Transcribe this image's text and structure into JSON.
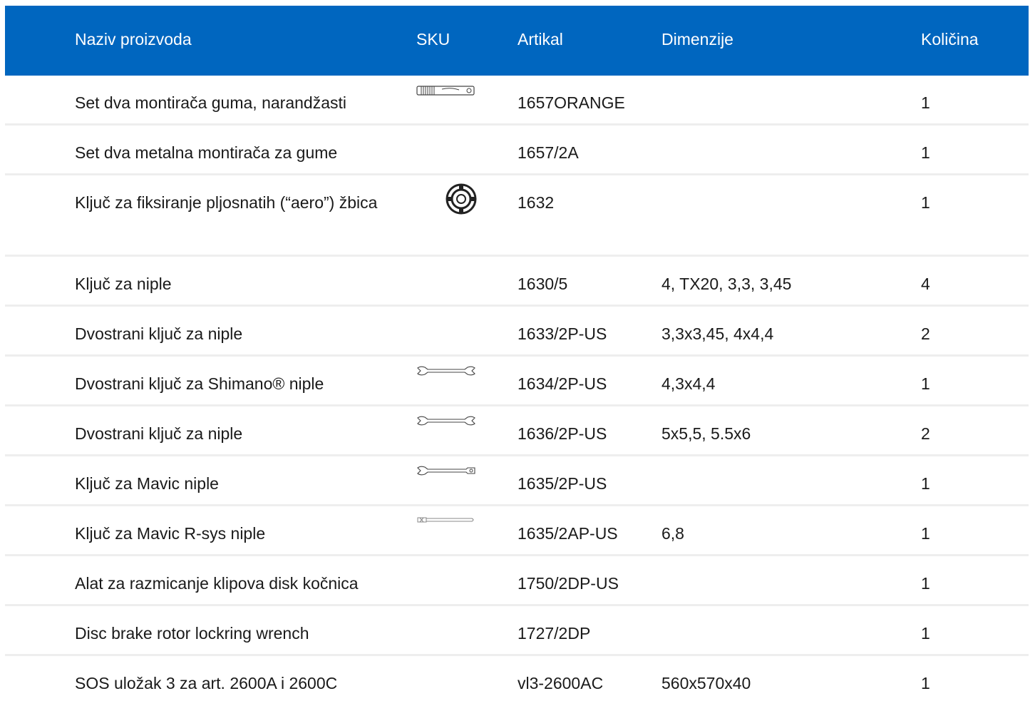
{
  "header": {
    "name": "Naziv proizvoda",
    "sku": "SKU",
    "article": "Artikal",
    "dimensions": "Dimenzije",
    "quantity": "Količina"
  },
  "rows": [
    {
      "name": "Set dva montirača guma, narandžasti",
      "sku_icon": "tire-lever-icon",
      "article": "1657ORANGE",
      "dimensions": "",
      "quantity": "1"
    },
    {
      "name": "Set dva metalna montirača za gume",
      "sku_icon": "",
      "article": "1657/2A",
      "dimensions": "",
      "quantity": "1"
    },
    {
      "name": "Ključ za fiksiranje pljosnatih (“aero”) žbica",
      "sku_icon": "aero-spoke-holder-icon",
      "article": "1632",
      "dimensions": "",
      "quantity": "1"
    },
    {
      "name": "Ključ za niple",
      "sku_icon": "",
      "article": "1630/5",
      "dimensions": "4, TX20, 3,3, 3,45",
      "quantity": "4"
    },
    {
      "name": "Dvostrani ključ za niple",
      "sku_icon": "",
      "article": "1633/2P-US",
      "dimensions": "3,3x3,45, 4x4,4",
      "quantity": "2"
    },
    {
      "name": "Dvostrani ključ za Shimano® niple",
      "sku_icon": "double-spoke-wrench-icon",
      "article": "1634/2P-US",
      "dimensions": "4,3x4,4",
      "quantity": "1"
    },
    {
      "name": "Dvostrani ključ za niple",
      "sku_icon": "double-spoke-wrench-icon",
      "article": "1636/2P-US",
      "dimensions": "5x5,5, 5.5x6",
      "quantity": "2"
    },
    {
      "name": "Ključ za Mavic niple",
      "sku_icon": "mavic-spoke-wrench-icon",
      "article": "1635/2P-US",
      "dimensions": "",
      "quantity": "1"
    },
    {
      "name": "Ključ za Mavic R-sys niple",
      "sku_icon": "rsys-spoke-wrench-icon",
      "article": "1635/2AP-US",
      "dimensions": "6,8",
      "quantity": "1"
    },
    {
      "name": "Alat za razmicanje klipova disk kočnica",
      "sku_icon": "",
      "article": "1750/2DP-US",
      "dimensions": "",
      "quantity": "1"
    },
    {
      "name": "Disc brake rotor lockring wrench",
      "sku_icon": "",
      "article": "1727/2DP",
      "dimensions": "",
      "quantity": "1"
    },
    {
      "name": "SOS uložak 3 za art. 2600A i 2600C",
      "sku_icon": "",
      "article": "vl3-2600AC",
      "dimensions": "560x570x40",
      "quantity": "1"
    }
  ]
}
